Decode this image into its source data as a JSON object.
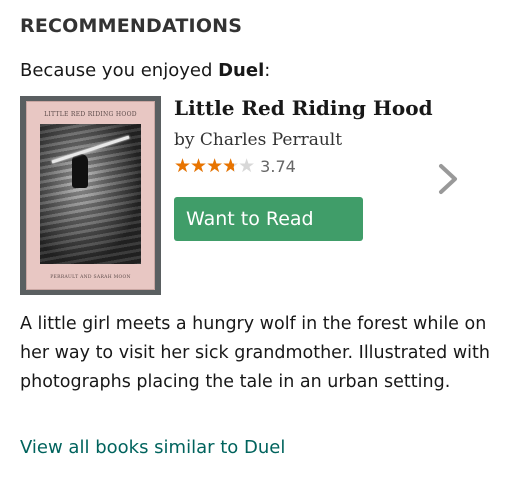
{
  "section": {
    "heading": "RECOMMENDATIONS",
    "because_prefix": "Because you enjoyed ",
    "because_book": "Duel",
    "because_suffix": ":"
  },
  "book": {
    "title": "Little Red Riding Hood",
    "author": "by Charles Perrault",
    "rating": "3.74",
    "rating_value": 3.74,
    "rating_max": 5,
    "description": "A little girl meets a hungry wolf in the forest while on her way to visit her sick grandmother. Illustrated with photographs placing the tale in an urban setting.",
    "cover": {
      "title_text": "Little Red Riding Hood",
      "author_text": "Perrault and Sarah Moon"
    }
  },
  "actions": {
    "want_to_read": "Want to Read",
    "view_all": "View all books similar to Duel"
  },
  "icons": {
    "next": "chevron-right-icon",
    "star": "star-icon"
  },
  "colors": {
    "button_green": "#409d69",
    "star_orange": "#e87400",
    "link_teal": "#00635d",
    "arrow_gray": "#999999"
  }
}
